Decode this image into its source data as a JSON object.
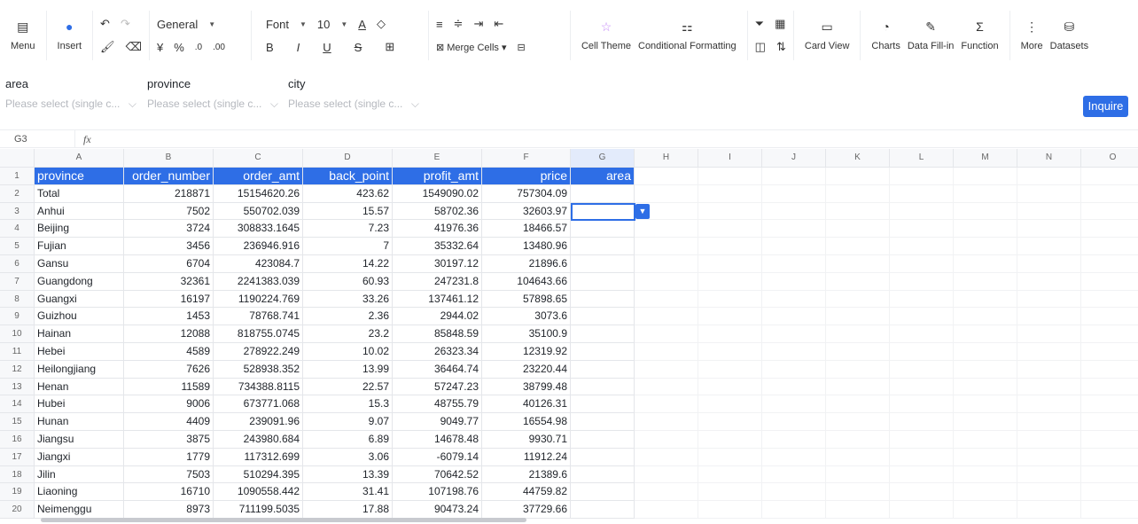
{
  "toolbar": {
    "menu": "Menu",
    "insert": "Insert",
    "number_format": "General",
    "font": "Font",
    "font_size": "10",
    "merge_cells": "Merge Cells",
    "cell_theme": "Cell Theme",
    "conditional_formatting": "Conditional Formatting",
    "card_view": "Card View",
    "charts": "Charts",
    "data_fill_in": "Data Fill-in",
    "function": "Function",
    "more": "More",
    "datasets": "Datasets",
    "accent": "#2e6ee6"
  },
  "filters": [
    {
      "label": "area",
      "placeholder": "Please select (single c..."
    },
    {
      "label": "province",
      "placeholder": "Please select (single c..."
    },
    {
      "label": "city",
      "placeholder": "Please select (single c..."
    }
  ],
  "inquire": "Inquire",
  "formula_bar": {
    "cell_ref": "G3",
    "fx": "fx",
    "value": ""
  },
  "columns": [
    "A",
    "B",
    "C",
    "D",
    "E",
    "F",
    "G",
    "H",
    "I",
    "J",
    "K",
    "L",
    "M",
    "N",
    "O"
  ],
  "header_row": [
    "province",
    "order_number",
    "order_amt",
    "back_point",
    "profit_amt",
    "price",
    "area"
  ],
  "rows": [
    [
      "Total",
      "218871",
      "15154620.26",
      "423.62",
      "1549090.02",
      "757304.09",
      ""
    ],
    [
      "Anhui",
      "7502",
      "550702.039",
      "15.57",
      "58702.36",
      "32603.97",
      ""
    ],
    [
      "Beijing",
      "3724",
      "308833.1645",
      "7.23",
      "41976.36",
      "18466.57",
      ""
    ],
    [
      "Fujian",
      "3456",
      "236946.916",
      "7",
      "35332.64",
      "13480.96",
      ""
    ],
    [
      "Gansu",
      "6704",
      "423084.7",
      "14.22",
      "30197.12",
      "21896.6",
      ""
    ],
    [
      "Guangdong",
      "32361",
      "2241383.039",
      "60.93",
      "247231.8",
      "104643.66",
      ""
    ],
    [
      "Guangxi",
      "16197",
      "1190224.769",
      "33.26",
      "137461.12",
      "57898.65",
      ""
    ],
    [
      "Guizhou",
      "1453",
      "78768.741",
      "2.36",
      "2944.02",
      "3073.6",
      ""
    ],
    [
      "Hainan",
      "12088",
      "818755.0745",
      "23.2",
      "85848.59",
      "35100.9",
      ""
    ],
    [
      "Hebei",
      "4589",
      "278922.249",
      "10.02",
      "26323.34",
      "12319.92",
      ""
    ],
    [
      "Heilongjiang",
      "7626",
      "528938.352",
      "13.99",
      "36464.74",
      "23220.44",
      ""
    ],
    [
      "Henan",
      "11589",
      "734388.8115",
      "22.57",
      "57247.23",
      "38799.48",
      ""
    ],
    [
      "Hubei",
      "9006",
      "673771.068",
      "15.3",
      "48755.79",
      "40126.31",
      ""
    ],
    [
      "Hunan",
      "4409",
      "239091.96",
      "9.07",
      "9049.77",
      "16554.98",
      ""
    ],
    [
      "Jiangsu",
      "3875",
      "243980.684",
      "6.89",
      "14678.48",
      "9930.71",
      ""
    ],
    [
      "Jiangxi",
      "1779",
      "117312.699",
      "3.06",
      "-6079.14",
      "11912.24",
      ""
    ],
    [
      "Jilin",
      "7503",
      "510294.395",
      "13.39",
      "70642.52",
      "21389.6",
      ""
    ],
    [
      "Liaoning",
      "16710",
      "1090558.442",
      "31.41",
      "107198.76",
      "44759.82",
      ""
    ],
    [
      "Neimenggu",
      "8973",
      "711199.5035",
      "17.88",
      "90473.24",
      "37729.66",
      ""
    ]
  ],
  "selected_cell": "G3"
}
